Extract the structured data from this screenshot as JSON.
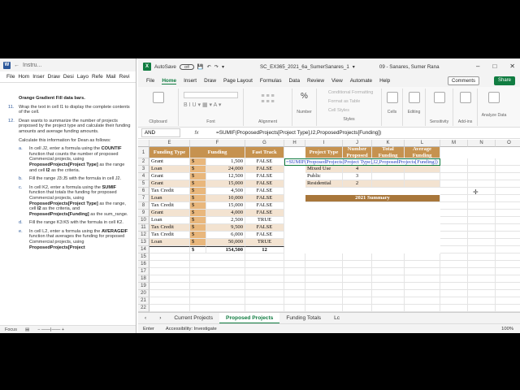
{
  "word": {
    "title": "Instru...",
    "menu": [
      "File",
      "Hom",
      "Inser",
      "Draw",
      "Desi",
      "Layo",
      "Refe",
      "Mail",
      "Revi"
    ],
    "lines": {
      "l0": "Orange Gradient Fill data bars.",
      "i11_num": "11.",
      "i11_text": "Wrap the text in cell I1 to display the complete contents of the cell.",
      "i12_num": "12.",
      "i12_text": "Dean wants to summarize the number of projects proposed by the project type and calculate their funding amounts and average funding amounts.",
      "p_calc": "Calculate this information for Dean as follows:",
      "a_num": "a.",
      "a_pre": "In cell J2, enter a formula using the ",
      "a_b1": "COUNTIF",
      "a_mid": " function that counts the number of proposed Commercial projects, using ",
      "a_b2": "ProposedProjects[Project Type]",
      "a_mid2": " as the range and cell ",
      "a_b3": "I2",
      "a_end": " as the criteria.",
      "b_num": "b.",
      "b_text": "Fill the range J3:J5 with the formula in cell J2.",
      "c_num": "c.",
      "c_pre": "In cell K2, enter a formula using the ",
      "c_b1": "SUMIF",
      "c_mid": " function that totals the funding for proposed Commercial projects, using ",
      "c_b2": "ProposedProjects[Project Type]",
      "c_mid2": " as the range, cell ",
      "c_b3": "I2",
      "c_mid3": " as the criteria, and ",
      "c_b4": "ProposedProjects[Funding]",
      "c_end": " as the sum_range.",
      "d_num": "d.",
      "d_text": "Fill the range K3:K5 with the formula in cell K2.",
      "e_num": "e.",
      "e_pre": "In cell L2, enter a formula using the ",
      "e_b1": "AVERAGEIF",
      "e_mid": " function that averages the funding for proposed Commercial projects, using ",
      "e_b2": "ProposedProjects[Project"
    },
    "status_focus": "Focus"
  },
  "excel": {
    "autosave_label": "AutoSave",
    "autosave_state": "Off",
    "filename": "SC_EX365_2021_6a_SumerSanares_1",
    "user": "09 - Sanares, Sumer Rana",
    "menu": [
      "File",
      "Home",
      "Insert",
      "Draw",
      "Page Layout",
      "Formulas",
      "Data",
      "Review",
      "View",
      "Automate",
      "Help"
    ],
    "comments_label": "Comments",
    "share_label": "Share",
    "ribbon": {
      "clipboard": "Clipboard",
      "font": "Font",
      "alignment": "Alignment",
      "number": "Number",
      "number_label": "%",
      "cf": "Conditional Formatting",
      "fat": "Format as Table",
      "cs": "Cell Styles",
      "styles": "Styles",
      "cells": "Cells",
      "editing": "Editing",
      "sensitivity": "Sensitivity",
      "addins": "Add-ins",
      "analyze": "Analyze Data"
    },
    "namebox": "AND",
    "fx": "fx",
    "formula": "=SUMIF(ProposedProjects[Project Type],I2,ProposedProjects[Funding])",
    "columns": [
      "E",
      "F",
      "G",
      "H",
      "I",
      "J",
      "K",
      "L",
      "M",
      "N",
      "O"
    ],
    "rows": [
      "1",
      "2",
      "3",
      "4",
      "5",
      "6",
      "7",
      "8",
      "9",
      "10",
      "11",
      "12",
      "13",
      "14",
      "15",
      "16",
      "17",
      "18",
      "19",
      "20",
      "21",
      "22",
      "23"
    ],
    "table_headers": [
      "Funding Type",
      "Funding",
      "Fast Track"
    ],
    "table_rows": [
      [
        "Grant",
        "$",
        "1,500",
        "FALSE"
      ],
      [
        "Loan",
        "$",
        "24,000",
        "FALSE"
      ],
      [
        "Grant",
        "$",
        "12,500",
        "FALSE"
      ],
      [
        "Grant",
        "$",
        "15,000",
        "FALSE"
      ],
      [
        "Tax Credit",
        "$",
        "4,500",
        "FALSE"
      ],
      [
        "Loan",
        "$",
        "10,000",
        "FALSE"
      ],
      [
        "Tax Credit",
        "$",
        "15,000",
        "FALSE"
      ],
      [
        "Grant",
        "$",
        "4,000",
        "FALSE"
      ],
      [
        "Loan",
        "$",
        "2,500",
        "TRUE"
      ],
      [
        "Tax Credit",
        "$",
        "9,500",
        "FALSE"
      ],
      [
        "Tax Credit",
        "$",
        "6,000",
        "FALSE"
      ],
      [
        "Loan",
        "$",
        "50,000",
        "TRUE"
      ]
    ],
    "totals": {
      "dollar": "$",
      "funding": "154,500",
      "fast": "12"
    },
    "summary_headers": [
      "Project Type",
      "Number Proposed",
      "Total Funding",
      "Average Funding"
    ],
    "edit_text": "=SUMIF(ProposedProjects[Project Type],I2,ProposedProjects[Funding])",
    "summary_rows": [
      [
        "Mixed Use",
        "4"
      ],
      [
        "Public",
        "3"
      ],
      [
        "Residential",
        "2"
      ]
    ],
    "summary_title": "2021 Summary",
    "tabs": [
      "Current Projects",
      "Proposed Projects",
      "Funding Totals",
      "Lc"
    ],
    "status_mode": "Enter",
    "status_access": "Accessibility: Investigate",
    "zoom": "100%"
  }
}
